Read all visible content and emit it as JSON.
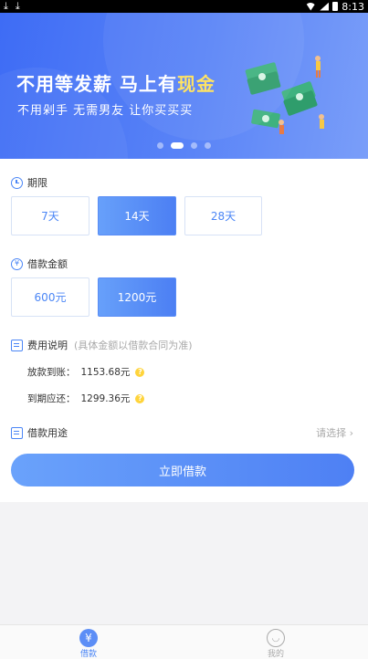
{
  "status_bar": {
    "time": "8:13",
    "left_icons": [
      "download-icon",
      "download-icon"
    ]
  },
  "banner": {
    "title_main": "不用等发薪 马上有",
    "title_highlight": "现金",
    "subtitle": "不用剁手 无需男友 让你买买买",
    "slides": 4,
    "active_slide": 2,
    "colors": {
      "highlight": "#ffe25a",
      "background": "#4a76f6"
    }
  },
  "term": {
    "label": "期限",
    "options": [
      "7天",
      "14天",
      "28天"
    ],
    "selected": "14天"
  },
  "amount": {
    "label": "借款金额",
    "options": [
      "600元",
      "1200元"
    ],
    "selected": "1200元"
  },
  "fees": {
    "label": "费用说明",
    "note": "(具体金额以借款合同为准)",
    "rows": [
      {
        "label": "放款到账：",
        "value": "1153.68元"
      },
      {
        "label": "到期应还：",
        "value": "1299.36元"
      }
    ]
  },
  "purpose": {
    "label": "借款用途",
    "placeholder": "请选择"
  },
  "submit_label": "立即借款",
  "bottom_nav": {
    "items": [
      {
        "label": "借款",
        "icon": "yen-icon",
        "active": true
      },
      {
        "label": "我的",
        "icon": "smiley-icon",
        "active": false
      }
    ]
  },
  "accent_color": "#4b86f6"
}
